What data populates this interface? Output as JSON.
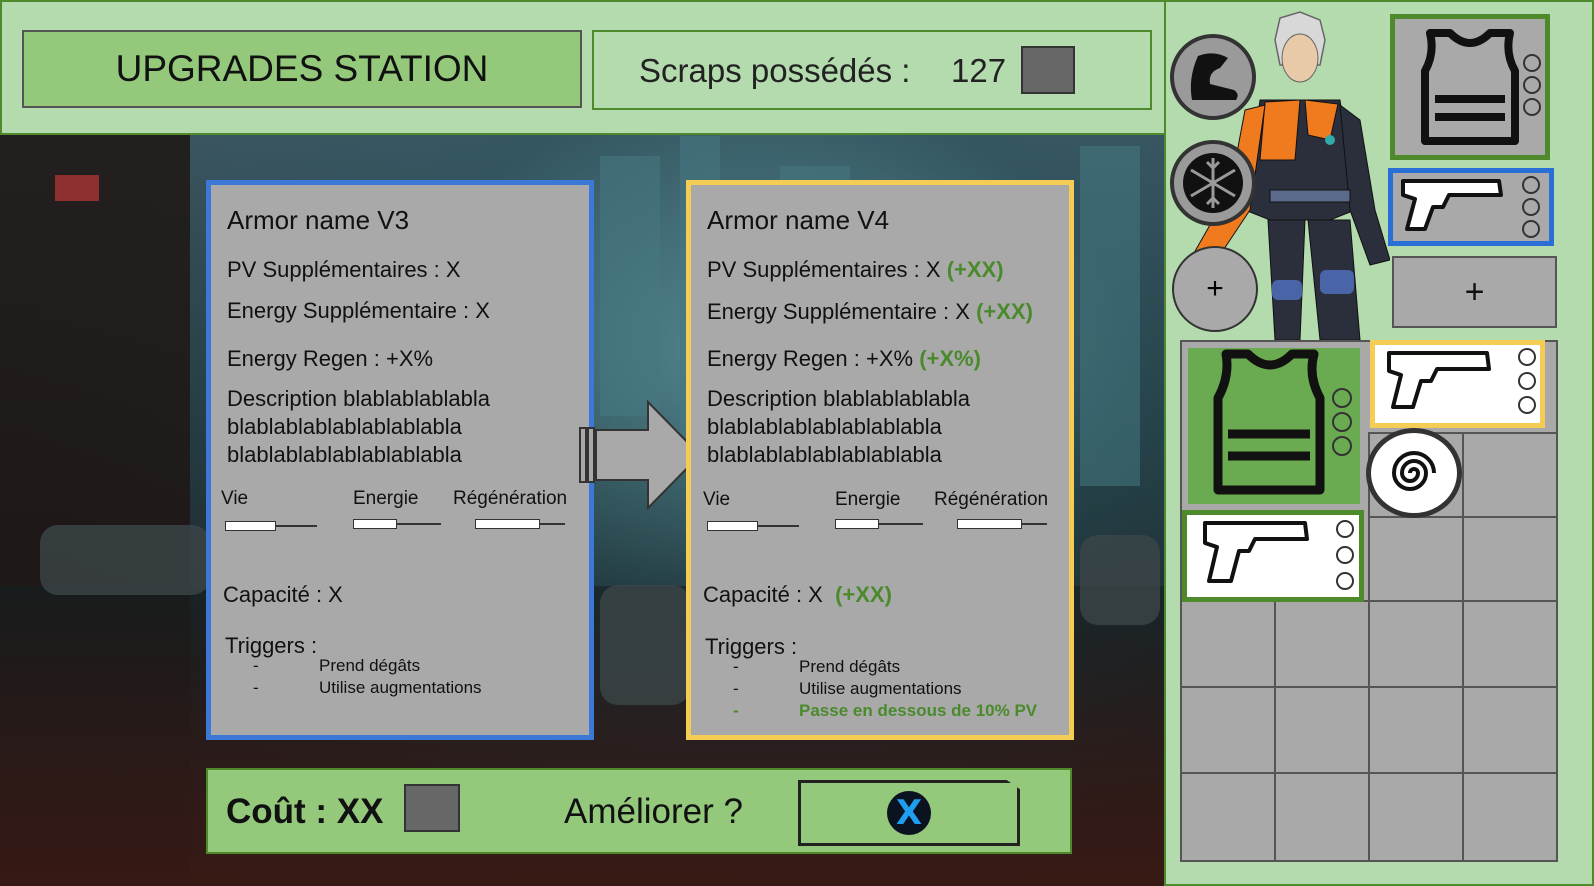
{
  "header": {
    "title": "UPGRADES STATION",
    "scraps_label": "Scraps possédés :",
    "scraps_value": "127"
  },
  "current": {
    "name": "Armor name V3",
    "pv": "PV Supplémentaires : X",
    "energy": "Energy Supplémentaire : X",
    "regen": "Energy Regen : +X%",
    "description": "Description blablablablabla blablablablablablablabla blablablablablablablabla",
    "bar_labels": [
      "Vie",
      "Energie",
      "Régénération"
    ],
    "bar_levels": [
      0.55,
      0.5,
      0.72
    ],
    "capacity": "Capacité : X",
    "triggers_label": "Triggers :",
    "triggers": [
      {
        "dash": "-",
        "text": "Prend dégâts"
      },
      {
        "dash": "-",
        "text": "Utilise augmentations"
      }
    ]
  },
  "next": {
    "name": "Armor name V4",
    "pv": "PV Supplémentaires : X",
    "pv_bonus": "(+XX)",
    "energy": "Energy Supplémentaire : X",
    "energy_bonus": "(+XX)",
    "regen": "Energy Regen : +X%",
    "regen_bonus": "(+X%)",
    "description": "Description blablablablabla blablablablablablablabla blablablablablablablabla",
    "bar_labels": [
      "Vie",
      "Energie",
      "Régénération"
    ],
    "bar_levels": [
      0.55,
      0.5,
      0.72
    ],
    "capacity": "Capacité : X",
    "capacity_bonus": "(+XX)",
    "triggers_label": "Triggers :",
    "triggers": [
      {
        "dash": "-",
        "text": "Prend dégâts"
      },
      {
        "dash": "-",
        "text": "Utilise augmentations"
      },
      {
        "dash": "-",
        "text": "Passe en dessous de 10% PV"
      }
    ]
  },
  "cost": {
    "label": "Coût : XX",
    "question": "Améliorer ?",
    "confirm_button": "X"
  },
  "equipment": {
    "abilities": [
      "boot-icon",
      "snowflake-icon",
      "add-ability"
    ],
    "add_symbol": "+",
    "add_slot_symbol": "+"
  },
  "colors": {
    "panel_green": "#b4dbae",
    "button_green": "#94c97c",
    "border_green": "#4e8a2c",
    "current_border": "#3b78d8",
    "next_border": "#f5cd55",
    "bonus_green": "#4a8a2c",
    "card_gray": "#a9a9a9"
  }
}
